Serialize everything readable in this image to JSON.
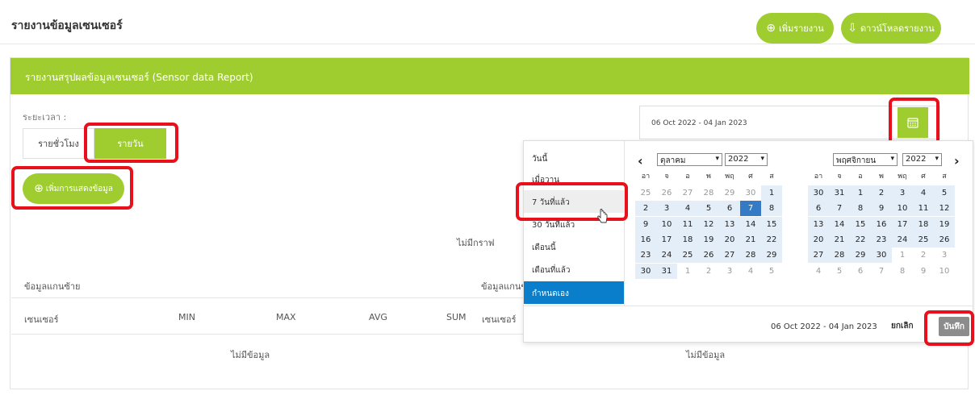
{
  "header": {
    "title": "รายงานข้อมูลเซนเซอร์",
    "add_report_label": "เพิ่มรายงาน",
    "download_report_label": "ดาวน์โหลดรายงาน",
    "add_icon": "plus-circle-icon",
    "download_icon": "download-icon"
  },
  "card": {
    "title": "รายงานสรุปผลข้อมูลเซนเซอร์ (Sensor data Report)",
    "period_label": "ระยะเวลา :",
    "hourly_label": "รายชั่วโมง",
    "daily_label": "รายวัน",
    "add_view_label": "เพิ่มการแสดงข้อมูล",
    "no_graph": "ไม่มีกราฟ",
    "left_axis": "ข้อมูลแกนซ้าย",
    "right_axis": "ข้อมูลแกนข",
    "columns": [
      "เซนเซอร์",
      "MIN",
      "MAX",
      "AVG",
      "SUM",
      "เซนเซอร์"
    ],
    "no_data": "ไม่มีข้อมูล"
  },
  "date_range": {
    "value": "06 Oct 2022 - 04 Jan 2023",
    "calendar_icon": "calendar-icon"
  },
  "picker": {
    "ranges": [
      "วันนี้",
      "เมื่อวาน",
      "7 วันที่แล้ว",
      "30 วันที่แล้ว",
      "เดือนนี้",
      "เดือนที่แล้ว",
      "กำหนดเอง"
    ],
    "hovered_range": "7 วันที่แล้ว",
    "active_range": "กำหนดเอง",
    "weekdays": [
      "อา",
      "จ",
      "อ",
      "พ",
      "พฤ",
      "ศ",
      "ส"
    ],
    "left_month": {
      "month": "ตุลาคม",
      "year": "2022",
      "days": [
        "25",
        "26",
        "27",
        "28",
        "29",
        "30",
        "1",
        "2",
        "3",
        "4",
        "5",
        "6",
        "7",
        "8",
        "9",
        "10",
        "11",
        "12",
        "13",
        "14",
        "15",
        "16",
        "17",
        "18",
        "19",
        "20",
        "21",
        "22",
        "23",
        "24",
        "25",
        "26",
        "27",
        "28",
        "29",
        "30",
        "31",
        "1",
        "2",
        "3",
        "4",
        "5"
      ]
    },
    "right_month": {
      "month": "พฤศจิกายน",
      "year": "2022",
      "days": [
        "30",
        "31",
        "1",
        "2",
        "3",
        "4",
        "5",
        "6",
        "7",
        "8",
        "9",
        "10",
        "11",
        "12",
        "13",
        "14",
        "15",
        "16",
        "17",
        "18",
        "19",
        "20",
        "21",
        "22",
        "23",
        "24",
        "25",
        "26",
        "27",
        "28",
        "29",
        "30",
        "1",
        "2",
        "3",
        "4",
        "5",
        "6",
        "7",
        "8",
        "9",
        "10"
      ]
    },
    "footer_range": "06 Oct 2022 - 04 Jan 2023",
    "cancel_label": "ยกเลิก",
    "save_label": "บันทึก",
    "prev_icon": "chevron-left-icon",
    "next_icon": "chevron-right-icon"
  },
  "colors": {
    "accent": "#9fcd30",
    "highlight": "#e8101a",
    "selected": "#347ac4",
    "active_range": "#0a7ecb"
  }
}
